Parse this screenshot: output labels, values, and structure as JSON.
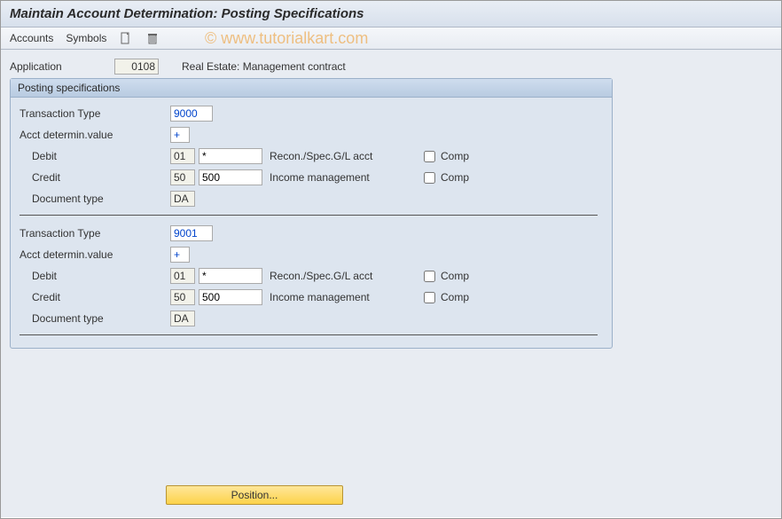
{
  "window": {
    "title": "Maintain Account Determination: Posting Specifications"
  },
  "menubar": {
    "accounts": "Accounts",
    "symbols": "Symbols",
    "create_icon": "create-document-icon",
    "delete_icon": "trash-icon"
  },
  "watermark": "© www.tutorialkart.com",
  "application": {
    "label": "Application",
    "code": "0108",
    "description": "Real Estate: Management contract"
  },
  "group": {
    "title": "Posting specifications",
    "labels": {
      "transaction_type": "Transaction Type",
      "acct_determ_value": "Acct determin.value",
      "debit": "Debit",
      "credit": "Credit",
      "document_type": "Document type",
      "comp": "Comp"
    },
    "specs": [
      {
        "transaction_type": "9000",
        "acct_determ_value": "+",
        "debit": {
          "pk": "01",
          "sym": "*",
          "gldesc": "Recon./Spec.G/L acct",
          "comp": false
        },
        "credit": {
          "pk": "50",
          "sym": "500",
          "gldesc": "Income management",
          "comp": false
        },
        "document_type": "DA"
      },
      {
        "transaction_type": "9001",
        "acct_determ_value": "+",
        "debit": {
          "pk": "01",
          "sym": "*",
          "gldesc": "Recon./Spec.G/L acct",
          "comp": false
        },
        "credit": {
          "pk": "50",
          "sym": "500",
          "gldesc": "Income management",
          "comp": false
        },
        "document_type": "DA"
      }
    ]
  },
  "footer": {
    "position_btn": "Position..."
  }
}
